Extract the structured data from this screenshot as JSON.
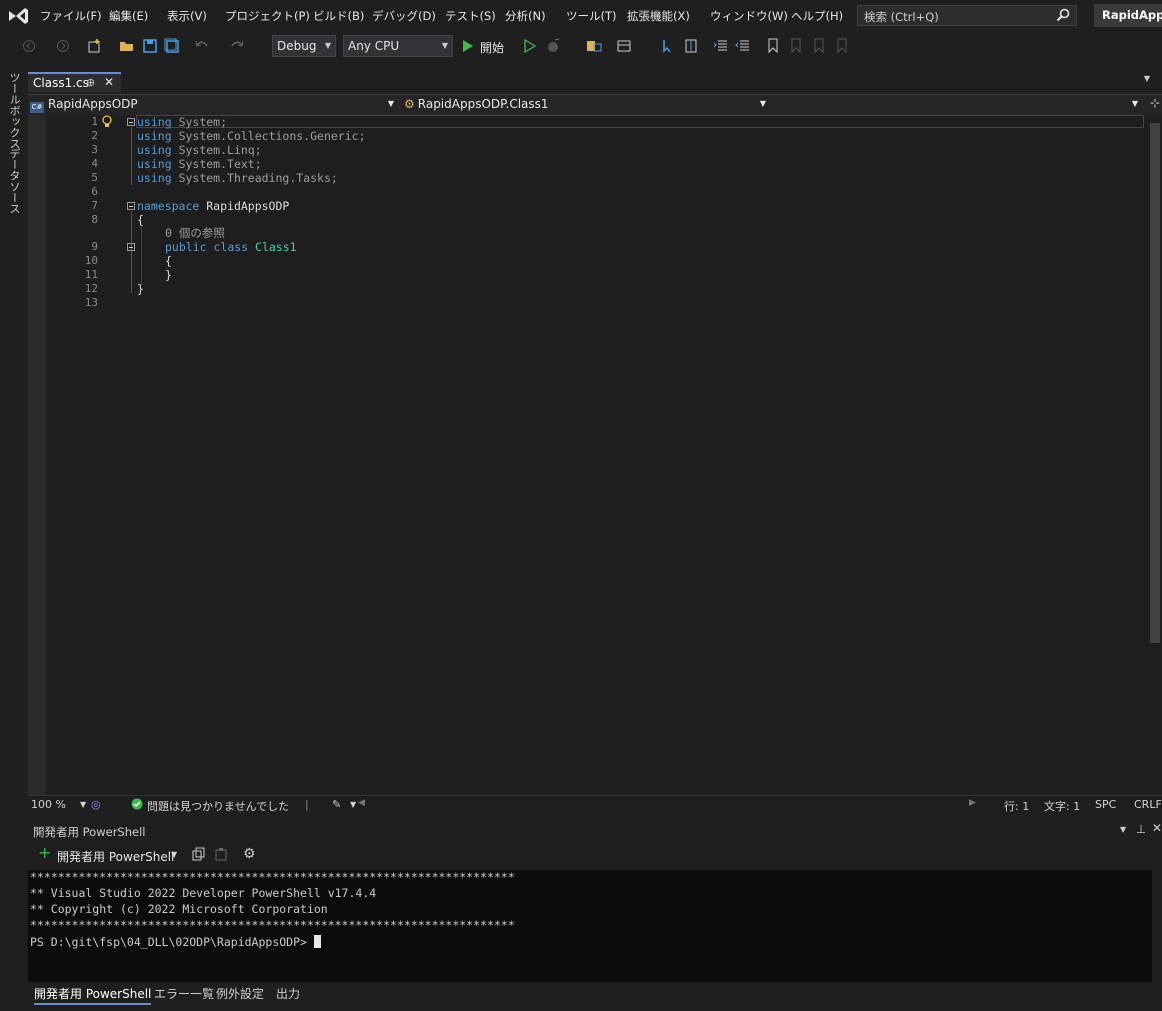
{
  "menu": [
    "ファイル(F)",
    "編集(E)",
    "表示(V)",
    "プロジェクト(P)",
    "ビルド(B)",
    "デバッグ(D)",
    "テスト(S)",
    "分析(N)",
    "ツール(T)",
    "拡張機能(X)",
    "ウィンドウ(W)",
    "ヘルプ(H)"
  ],
  "search": {
    "placeholder": "検索 (Ctrl+Q)"
  },
  "solution_name": "RapidAppsODP",
  "toolbar": {
    "config": "Debug",
    "platform": "Any CPU",
    "start_label": "開始"
  },
  "left_rail": [
    "ツールボックス",
    "データソース"
  ],
  "editor_tab": {
    "label": "Class1.cs",
    "pin": "⊕",
    "close": "✕"
  },
  "navbar": {
    "project": "RapidAppsODP",
    "class": "RapidAppsODP.Class1",
    "member": ""
  },
  "code": {
    "line_numbers": [
      "1",
      "2",
      "3",
      "4",
      "5",
      "6",
      "7",
      "8",
      "9",
      "10",
      "11",
      "12",
      "13"
    ],
    "kw_using": "using",
    "usings": [
      "System;",
      "System.Collections.Generic;",
      "System.Linq;",
      "System.Text;",
      "System.Threading.Tasks;"
    ],
    "kw_namespace": "namespace",
    "namespace_name": "RapidAppsODP",
    "open_brace": "{",
    "close_brace": "}",
    "ref_count": "0 個の参照",
    "kw_public": "public",
    "kw_class": "class",
    "class_name": "Class1"
  },
  "status": {
    "zoom": "100 %",
    "issues": "問題は見つかりませんでした",
    "line": "行: 1",
    "col": "文字: 1",
    "spc": "SPC",
    "eol": "CRLF"
  },
  "panel": {
    "title": "開発者用 PowerShell",
    "new_terminal": "開発者用 PowerShell",
    "terminal_lines": [
      "**********************************************************************",
      "** Visual Studio 2022 Developer PowerShell v17.4.4",
      "** Copyright (c) 2022 Microsoft Corporation",
      "**********************************************************************"
    ],
    "prompt": "PS D:\\git\\fsp\\04_DLL\\02ODP\\RapidAppsODP> "
  },
  "bottom_tabs": [
    "開発者用 PowerShell",
    "エラー一覧",
    "例外設定",
    "出力"
  ],
  "colors": {
    "accent": "#6b8cc7",
    "keyword": "#569cd6",
    "type": "#4ec9b0",
    "start_green": "#3fb950"
  }
}
